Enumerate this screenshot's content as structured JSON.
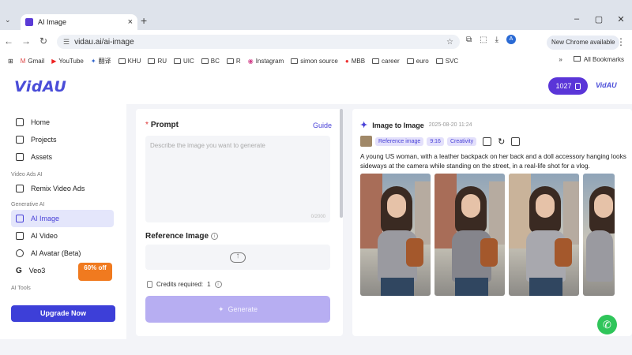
{
  "browser": {
    "tab_title": "AI Image",
    "url": "vidau.ai/ai-image",
    "new_chrome": "New Chrome available",
    "bookmarks": [
      "Gmail",
      "YouTube",
      "翻译",
      "KHU",
      "RU",
      "UIC",
      "BC",
      "R",
      "Instagram",
      "simon source",
      "MBB",
      "career",
      "euro",
      "SVC"
    ],
    "all_bookmarks": "All Bookmarks"
  },
  "app": {
    "logo": "VidAU",
    "logo_small": "VidAU",
    "credits": "1027",
    "sidebar": {
      "home": "Home",
      "projects": "Projects",
      "assets": "Assets",
      "section_video_ads": "Video Ads AI",
      "remix": "Remix Video Ads",
      "section_generative": "Generative AI",
      "ai_image": "AI Image",
      "ai_video": "AI Video",
      "ai_avatar": "AI Avatar (Beta)",
      "veo3": "Veo3",
      "badge": "60% off",
      "section_tools": "AI Tools",
      "upgrade": "Upgrade Now"
    },
    "left_panel": {
      "prompt_title": "Prompt",
      "guide": "Guide",
      "prompt_placeholder": "Describe the image you want to generate",
      "counter": "0/2000",
      "reference_title": "Reference Image",
      "credits_label": "Credits required:",
      "credits_value": "1",
      "generate": "Generate"
    },
    "right_panel": {
      "title": "Image to Image",
      "date": "2025-08-20 11:24",
      "tags": [
        "Reference image",
        "9:16",
        "Creativity"
      ],
      "description": "A young US woman, with a leather backpack on her back and a doll accessory hanging looks sideways at the camera while standing on the street, in a real-life shot for a vlog."
    }
  },
  "colors": {
    "accent": "#4a42d8",
    "brand": "#5a35d8",
    "badge": "#f07a1f",
    "generate": "#b7aef2"
  }
}
